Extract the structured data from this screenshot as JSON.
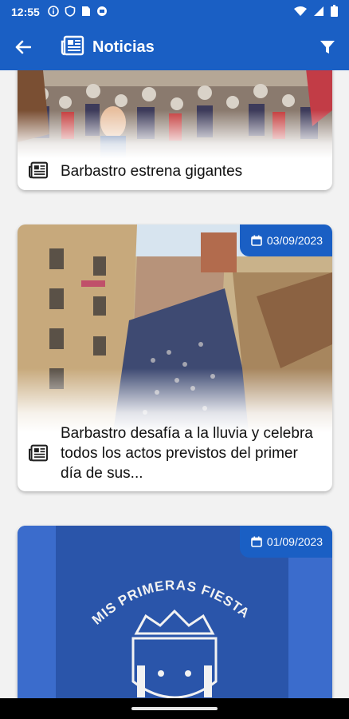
{
  "status_bar": {
    "time": "12:55",
    "left_icons": [
      "info-icon",
      "vpn-icon",
      "sim-icon",
      "notification-icon"
    ],
    "right_icons": [
      "wifi-icon",
      "signal-icon",
      "battery-icon"
    ]
  },
  "app_bar": {
    "title": "Noticias",
    "back_icon": "arrow-back-icon",
    "title_icon": "newspaper-icon",
    "filter_icon": "filter-icon"
  },
  "news": [
    {
      "title": "Barbastro estrena gigantes",
      "date": "",
      "image": "crowd-with-giants-photo"
    },
    {
      "title": "Barbastro desafía a la lluvia y celebra todos los actos previstos del primer día de sus...",
      "date": "03/09/2023",
      "image": "crowded-street-aerial-photo"
    },
    {
      "title": "",
      "date": "01/09/2023",
      "image": "mis-primeras-fiestas-shirt-photo",
      "image_text": "MIS PRIMERAS FIESTAS"
    }
  ],
  "colors": {
    "primary": "#1a5fc4",
    "background": "#f2f2f2",
    "card": "#ffffff"
  }
}
